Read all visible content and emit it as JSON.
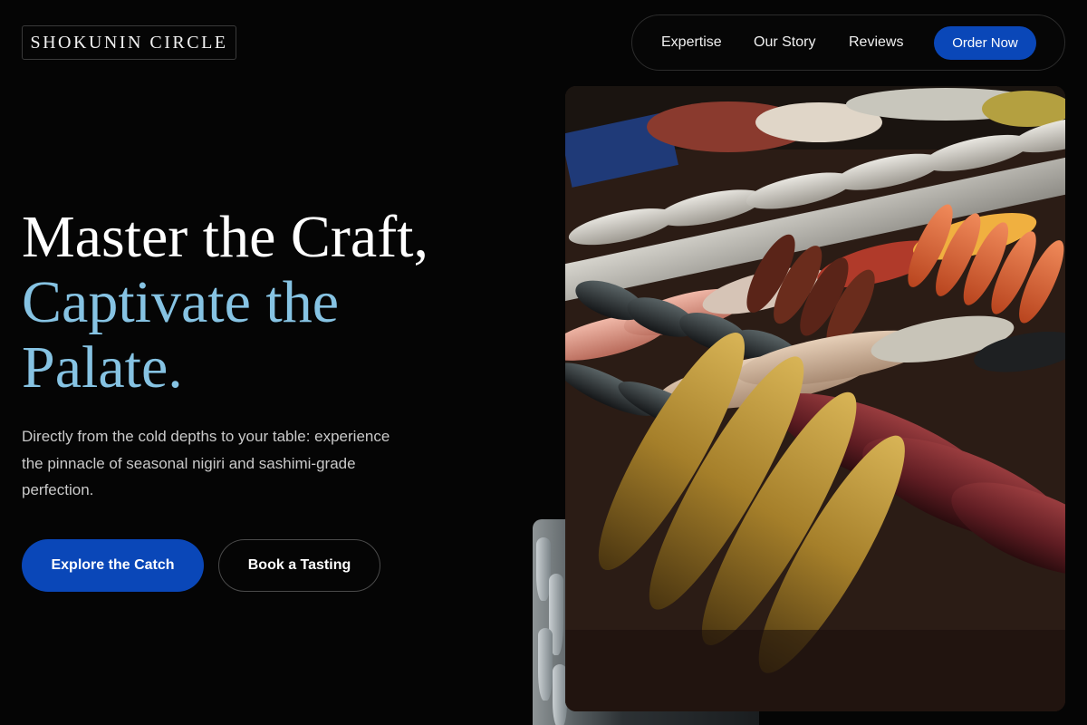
{
  "brand": {
    "name": "SHOKUNIN CIRCLE"
  },
  "nav": {
    "links": [
      "Expertise",
      "Our Story",
      "Reviews"
    ],
    "cta_label": "Order Now"
  },
  "hero": {
    "headline_line1": "Master the Craft,",
    "headline_line2": "Captivate the",
    "headline_line3": "Palate.",
    "subtext": "Directly from the cold depths to your table: experience the pinnacle of seasonal nigiri and sashimi-grade perfection.",
    "primary_button": "Explore the Catch",
    "secondary_button": "Book a Tasting"
  },
  "colors": {
    "background": "#050505",
    "accent_blue": "#0a47b8",
    "headline_highlight": "#86c3e3",
    "body_text": "#c9c9c9"
  },
  "images": {
    "main": "fish-market-display-photo",
    "secondary": "fish-on-ice-photo"
  }
}
